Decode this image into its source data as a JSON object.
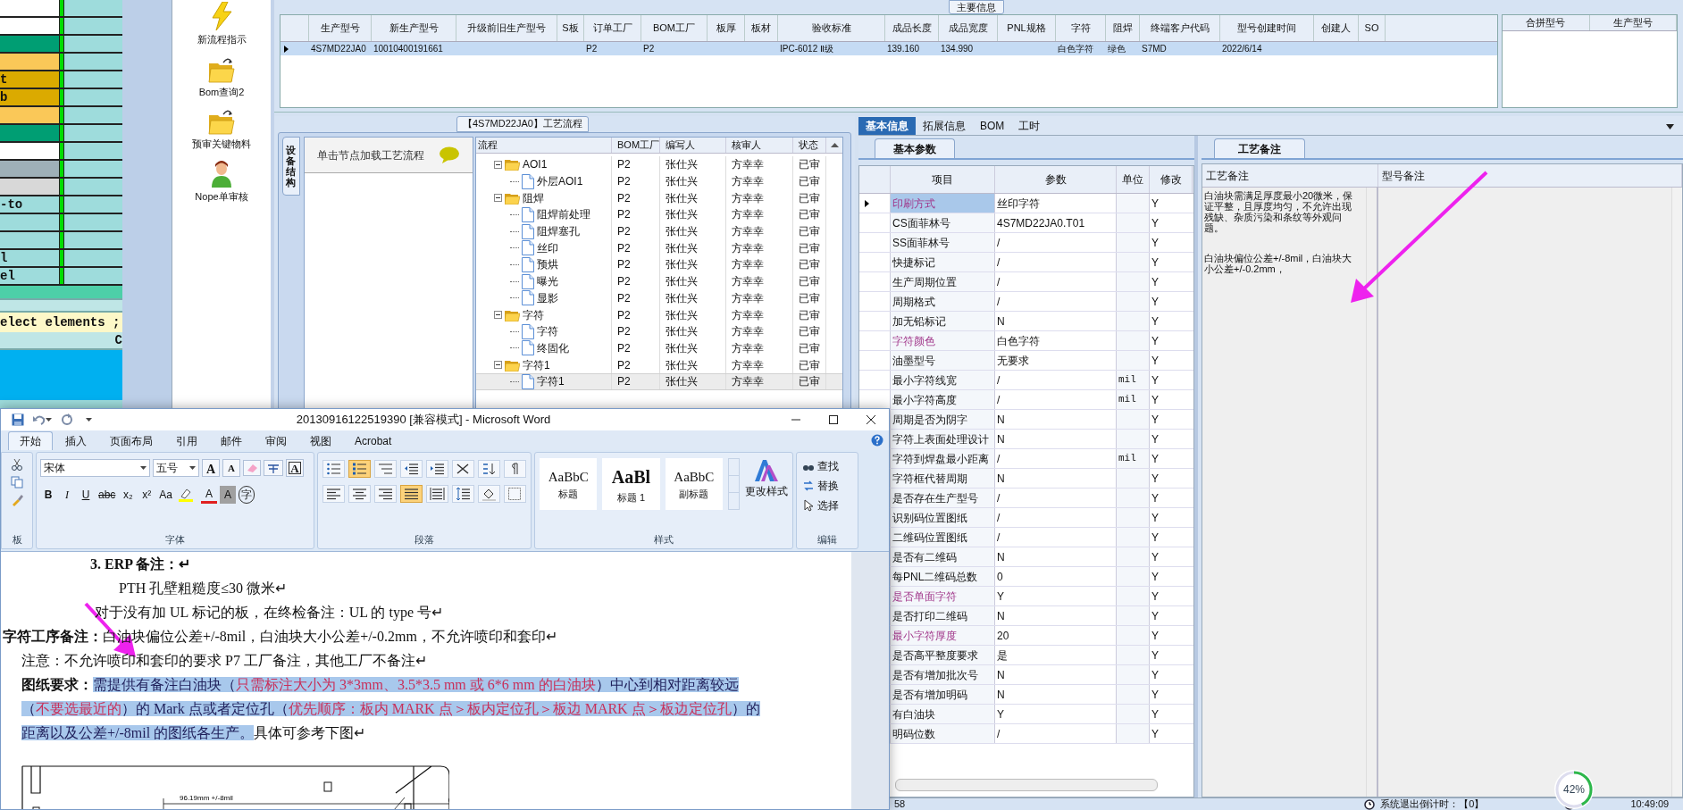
{
  "left_strip": {
    "rows": [
      {
        "color": "#ffffff"
      },
      {
        "color": "#ffffff"
      },
      {
        "color": "#009e73"
      },
      {
        "color": "#fac858"
      },
      {
        "color": "#dbaa00",
        "text": "t"
      },
      {
        "color": "#dbaa00",
        "text": "b"
      },
      {
        "color": "#fac858"
      },
      {
        "color": "#009e73"
      },
      {
        "color": "#ffffff"
      },
      {
        "color": "#9fb0b8"
      },
      {
        "color": "#d8d8d8"
      },
      {
        "color": "#9edcdc",
        "text": "-to"
      },
      {
        "color": "#9edcdc"
      },
      {
        "color": "#9edcdc"
      },
      {
        "color": "#9edcdc",
        "text": "l"
      },
      {
        "color": "#9edcdc",
        "text": "el"
      }
    ],
    "console": "elect elements ;",
    "console_right": "C"
  },
  "toolbar": {
    "items": [
      {
        "label": "新流程指示",
        "kind": "lightning"
      },
      {
        "label": "Bom查询2",
        "kind": "folder"
      },
      {
        "label": "预审关键物料",
        "kind": "folder"
      },
      {
        "label": "Nope单审核",
        "kind": "person"
      }
    ]
  },
  "main_info": {
    "title": "主要信息",
    "columns": [
      "生产型号",
      "新生产型号",
      "升级前旧生产型号",
      "S板",
      "订单工厂",
      "BOM工厂",
      "板厚",
      "板材",
      "验收标准",
      "成品长度",
      "成品宽度",
      "PNL规格",
      "字符",
      "阻焊",
      "终端客户代码",
      "型号创建时间",
      "创建人",
      "SO"
    ],
    "rows": [
      {
        "selected": true,
        "cells": [
          "4S7MD22JA0",
          "10010400191661",
          null,
          null,
          "P2",
          "P2",
          null,
          null,
          "IPC-6012 Ⅱ级",
          "139.160",
          "134.990",
          null,
          "白色字符",
          "绿色",
          "S7MD",
          "2022/6/14",
          null,
          null
        ]
      }
    ],
    "merge_columns": [
      "合拼型号",
      "生产型号"
    ]
  },
  "process": {
    "title": "【4S7MD22JA0】工艺流程",
    "side_tab": "设备结构",
    "hint": "单击节点加载工艺流程",
    "columns": [
      "流程",
      "BOM工厂",
      "编写人",
      "核审人",
      "状态"
    ],
    "tree": [
      {
        "kind": "folder",
        "label": "AOI1",
        "expanded": true,
        "selected": false,
        "bom": "P2",
        "writer": "张仕兴",
        "reviewer": "方幸幸",
        "status": "已审",
        "children": [
          {
            "kind": "step",
            "label": "外层AOI1",
            "selected": false,
            "bom": "P2",
            "writer": "张仕兴",
            "reviewer": "方幸幸",
            "status": "已审"
          }
        ]
      },
      {
        "kind": "folder",
        "label": "阻焊",
        "expanded": true,
        "selected": false,
        "bom": "P2",
        "writer": "张仕兴",
        "reviewer": "方幸幸",
        "status": "已审",
        "children": [
          {
            "kind": "step",
            "label": "阻焊前处理",
            "selected": false,
            "bom": "P2",
            "writer": "张仕兴",
            "reviewer": "方幸幸",
            "status": "已审"
          },
          {
            "kind": "step",
            "label": "阻焊塞孔",
            "selected": false,
            "bom": "P2",
            "writer": "张仕兴",
            "reviewer": "方幸幸",
            "status": "已审"
          },
          {
            "kind": "step",
            "label": "丝印",
            "selected": false,
            "bom": "P2",
            "writer": "张仕兴",
            "reviewer": "方幸幸",
            "status": "已审"
          },
          {
            "kind": "step",
            "label": "预烘",
            "selected": false,
            "bom": "P2",
            "writer": "张仕兴",
            "reviewer": "方幸幸",
            "status": "已审"
          },
          {
            "kind": "step",
            "label": "曝光",
            "selected": false,
            "bom": "P2",
            "writer": "张仕兴",
            "reviewer": "方幸幸",
            "status": "已审"
          },
          {
            "kind": "step",
            "label": "显影",
            "selected": false,
            "bom": "P2",
            "writer": "张仕兴",
            "reviewer": "方幸幸",
            "status": "已审"
          }
        ]
      },
      {
        "kind": "folder",
        "label": "字符",
        "expanded": true,
        "selected": false,
        "bom": "P2",
        "writer": "张仕兴",
        "reviewer": "方幸幸",
        "status": "已审",
        "children": [
          {
            "kind": "step",
            "label": "字符",
            "selected": false,
            "bom": "P2",
            "writer": "张仕兴",
            "reviewer": "方幸幸",
            "status": "已审"
          },
          {
            "kind": "step",
            "label": "终固化",
            "selected": false,
            "bom": "P2",
            "writer": "张仕兴",
            "reviewer": "方幸幸",
            "status": "已审"
          }
        ]
      },
      {
        "kind": "folder",
        "label": "字符1",
        "expanded": true,
        "selected": false,
        "bom": "P2",
        "writer": "张仕兴",
        "reviewer": "方幸幸",
        "status": "已审",
        "children": [
          {
            "kind": "step",
            "label": "字符1",
            "selected": true,
            "bom": "P2",
            "writer": "张仕兴",
            "reviewer": "方幸幸",
            "status": "已审"
          }
        ]
      }
    ]
  },
  "detail": {
    "tabs": [
      {
        "label": "基本信息",
        "selected": true
      },
      {
        "label": "拓展信息",
        "selected": false
      },
      {
        "label": "BOM",
        "selected": false
      },
      {
        "label": "工时",
        "selected": false
      }
    ],
    "sub_tab": "基本参数",
    "columns": [
      "项目",
      "参数",
      "单位",
      "修改"
    ],
    "params": [
      {
        "item": "印刷方式",
        "value": "丝印字符",
        "edit": "Y",
        "flagged": true,
        "selected": true
      },
      {
        "item": "CS面菲林号",
        "value": "4S7MD22JA0.T01",
        "edit": "Y",
        "flagged": false,
        "selected": false
      },
      {
        "item": "SS面菲林号",
        "value": "/",
        "edit": "Y",
        "flagged": false,
        "selected": false
      },
      {
        "item": "快捷标记",
        "value": "/",
        "edit": "Y",
        "flagged": false,
        "selected": false
      },
      {
        "item": "生产周期位置",
        "value": "/",
        "edit": "Y",
        "flagged": false,
        "selected": false
      },
      {
        "item": "周期格式",
        "value": "/",
        "edit": "Y",
        "flagged": false,
        "selected": false
      },
      {
        "item": "加无铅标记",
        "value": "N",
        "edit": "Y",
        "flagged": false,
        "selected": false
      },
      {
        "item": "字符颜色",
        "value": "白色字符",
        "edit": "Y",
        "flagged": true,
        "selected": false
      },
      {
        "item": "油墨型号",
        "value": "无要求",
        "edit": "Y",
        "flagged": false,
        "selected": false
      },
      {
        "item": "最小字符线宽",
        "value": "/",
        "unit": "mil",
        "edit": "Y",
        "flagged": false,
        "selected": false
      },
      {
        "item": "最小字符高度",
        "value": "/",
        "unit": "mil",
        "edit": "Y",
        "flagged": false,
        "selected": false
      },
      {
        "item": "周期是否为阴字",
        "value": "N",
        "edit": "Y",
        "flagged": false,
        "selected": false
      },
      {
        "item": "字符上表面处理设计",
        "value": "N",
        "edit": "Y",
        "flagged": false,
        "selected": false
      },
      {
        "item": "字符到焊盘最小距离",
        "value": "/",
        "unit": "mil",
        "edit": "Y",
        "flagged": false,
        "selected": false
      },
      {
        "item": "字符框代替周期",
        "value": "N",
        "edit": "Y",
        "flagged": false,
        "selected": false
      },
      {
        "item": "是否存在生产型号",
        "value": "/",
        "edit": "Y",
        "flagged": false,
        "selected": false
      },
      {
        "item": "识别码位置图纸",
        "value": "/",
        "edit": "Y",
        "flagged": false,
        "selected": false
      },
      {
        "item": "二维码位置图纸",
        "value": "/",
        "edit": "Y",
        "flagged": false,
        "selected": false
      },
      {
        "item": "是否有二维码",
        "value": "N",
        "edit": "Y",
        "flagged": false,
        "selected": false
      },
      {
        "item": "每PNL二维码总数",
        "value": "0",
        "edit": "Y",
        "flagged": false,
        "selected": false
      },
      {
        "item": "是否单面字符",
        "value": "Y",
        "edit": "Y",
        "flagged": true,
        "selected": false
      },
      {
        "item": "是否打印二维码",
        "value": "N",
        "edit": "Y",
        "flagged": false,
        "selected": false
      },
      {
        "item": "最小字符厚度",
        "value": "20",
        "edit": "Y",
        "flagged": true,
        "selected": false
      },
      {
        "item": "是否高平整度要求",
        "value": "是",
        "edit": "Y",
        "flagged": false,
        "selected": false
      },
      {
        "item": "是否有增加批次号",
        "value": "N",
        "edit": "Y",
        "flagged": false,
        "selected": false
      },
      {
        "item": "是否有增加明码",
        "value": "N",
        "edit": "Y",
        "flagged": false,
        "selected": false
      },
      {
        "item": "有白油块",
        "value": "Y",
        "edit": "Y",
        "flagged": false,
        "selected": false
      },
      {
        "item": "明码位数",
        "value": "/",
        "edit": "Y",
        "flagged": false,
        "selected": false
      }
    ],
    "notes_tab": "工艺备注",
    "notes_columns": [
      "工艺备注",
      "型号备注"
    ],
    "notes": [
      "白油块需满足厚度最小20微米，保证平整，且厚度均匀，不允许出现残缺、杂质污染和条纹等外观问题。",
      "白油块偏位公差+/-8mil，白油块大小公差+/-0.2mm，"
    ]
  },
  "status_bar": {
    "count": "58",
    "countdown": "系统退出倒计时：【0】",
    "time": "10:49:09",
    "gauge": {
      "text": "42%",
      "level": 0.42
    }
  },
  "word": {
    "title": "20130916122519390 [兼容模式] - Microsoft Word",
    "tabs": [
      {
        "label": "开始",
        "selected": true
      },
      {
        "label": "插入",
        "selected": false
      },
      {
        "label": "页面布局",
        "selected": false
      },
      {
        "label": "引用",
        "selected": false
      },
      {
        "label": "邮件",
        "selected": false
      },
      {
        "label": "审阅",
        "selected": false
      },
      {
        "label": "视图",
        "selected": false
      },
      {
        "label": "Acrobat",
        "selected": false
      }
    ],
    "clipboard_label": "板",
    "font": {
      "name": "宋体",
      "size": "五号",
      "row1": [
        "A",
        "A",
        "A"
      ],
      "row2": [
        {
          "label": "B",
          "kind": "bold"
        },
        {
          "label": "I",
          "kind": "italic"
        },
        {
          "label": "U",
          "kind": "underline"
        },
        {
          "label": "abc",
          "kind": "strike"
        },
        {
          "label": "x₂",
          "kind": "plain"
        },
        {
          "label": "x²",
          "kind": "plain"
        },
        {
          "label": "Aa",
          "kind": "plain"
        },
        {
          "label": "A",
          "kind": "color"
        },
        {
          "label": "A",
          "kind": "shade"
        },
        {
          "label": "字",
          "kind": "enclose"
        }
      ],
      "label": "字体"
    },
    "paragraph": {
      "row1": [
        {
          "kind": "bullets",
          "on": false
        },
        {
          "kind": "numbering",
          "on": true
        },
        {
          "kind": "multilevel",
          "on": false
        },
        {
          "kind": "outdent",
          "on": false
        },
        {
          "kind": "indent",
          "on": false
        },
        {
          "kind": "cross",
          "on": false
        },
        {
          "kind": "sort",
          "on": false
        },
        {
          "kind": "marks",
          "on": false
        }
      ],
      "row2": [
        {
          "kind": "left",
          "on": false
        },
        {
          "kind": "center",
          "on": false
        },
        {
          "kind": "right",
          "on": false
        },
        {
          "kind": "justify",
          "on": true
        },
        {
          "kind": "distributed",
          "on": false
        },
        {
          "kind": "spacing",
          "on": false
        },
        {
          "kind": "fill",
          "on": false
        },
        {
          "kind": "border",
          "on": false
        }
      ],
      "label": "段落"
    },
    "styles": {
      "items": [
        {
          "preview": "AaBbC",
          "name": "标题",
          "kind": "normal"
        },
        {
          "preview": "AaBl",
          "name": "标题 1",
          "kind": "large"
        },
        {
          "preview": "AaBbC",
          "name": "副标题",
          "kind": "normal"
        }
      ],
      "change": "更改样式",
      "label": "样式"
    },
    "editing": {
      "items": [
        "查找",
        "替换",
        "选择"
      ],
      "label": "编辑"
    },
    "document": [
      {
        "kind": "heading",
        "text": "3. ERP 备注：↵"
      },
      {
        "kind": "item",
        "text": "PTH 孔壁粗糙度≤30 微米↵"
      },
      {
        "kind": "body",
        "text": "对于没有加 UL 标记的板，在终检备注：UL 的 type 号↵"
      },
      {
        "kind": "section",
        "text": "**字符工序备注：**白油块偏位公差+/-8mil，白油块大小公差+/-0.2mm，不允许喷印和套印↵"
      },
      {
        "kind": "note",
        "text": "注意：不允许喷印和套印的要求 P7 工厂备注，其他工厂不备注↵"
      },
      {
        "kind": "requirement",
        "segments": [
          {
            "kind": "label",
            "text": "图纸要求："
          },
          {
            "kind": "selected",
            "text": "需提供有备注白油块（"
          },
          {
            "kind": "selected_red",
            "text": "只需标注大小为 3*3mm、3.5*3.5 mm 或 6*6 mm 的白油块"
          },
          {
            "kind": "selected",
            "text": "）中心到相对距离较远（"
          },
          {
            "kind": "selected_red",
            "text": "不要选最近的"
          },
          {
            "kind": "selected",
            "text": "）的 Mark 点或者定位孔（"
          },
          {
            "kind": "selected_red",
            "text": "优先顺序：板内 MARK 点＞板内定位孔＞板边 MARK 点＞板边定位孔"
          },
          {
            "kind": "selected",
            "text": "）的距离以及公差+/-8mil 的图纸各生产。"
          },
          {
            "kind": "plain",
            "text": "具体可参考下图↵"
          }
        ]
      }
    ],
    "drawing_label": "96.19mm +/-8mil"
  }
}
